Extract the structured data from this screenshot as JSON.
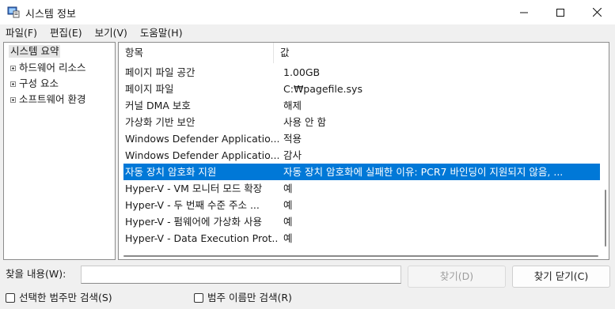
{
  "window": {
    "title": "시스템 정보"
  },
  "menu": [
    "파일(F)",
    "편집(E)",
    "보기(V)",
    "도움말(H)"
  ],
  "tree": {
    "root": "시스템 요약",
    "items": [
      "하드웨어 리소스",
      "구성 요소",
      "소프트웨어 환경"
    ]
  },
  "list": {
    "header_item": "항목",
    "header_value": "값",
    "rows": [
      {
        "item": "페이지 파일 공간",
        "value": "1.00GB"
      },
      {
        "item": "페이지 파일",
        "value": "C:₩pagefile.sys"
      },
      {
        "item": "커널 DMA 보호",
        "value": "해제"
      },
      {
        "item": "가상화 기반 보안",
        "value": "사용 안 함"
      },
      {
        "item": "Windows Defender Applicatio...",
        "value": "적용"
      },
      {
        "item": "Windows Defender Applicatio...",
        "value": "감사"
      },
      {
        "item": "자동 장치 암호화 지원",
        "value": "자동 장치 암호화에 실패한 이유: PCR7 바인딩이 지원되지 않음, ..."
      },
      {
        "item": "Hyper-V - VM 모니터 모드 확장",
        "value": "예"
      },
      {
        "item": "Hyper-V - 두 번째 수준 주소 ...",
        "value": "예"
      },
      {
        "item": "Hyper-V - 펌웨어에 가상화 사용",
        "value": "예"
      },
      {
        "item": "Hyper-V - Data Execution Prot...",
        "value": "예"
      }
    ],
    "selected_index": 6
  },
  "find": {
    "label": "찾을 내용(W):",
    "input_value": "",
    "find_button": "찾기(D)",
    "close_button": "찾기 닫기(C)",
    "check_selected_category": "선택한 범주만 검색(S)",
    "check_category_names": "범주 이름만 검색(R)"
  },
  "colors": {
    "selection": "#0078d7",
    "disabled_text": "#9d9d9d"
  },
  "icons": [
    "app-icon",
    "minimize-icon",
    "maximize-icon",
    "close-icon",
    "expand-icon"
  ]
}
